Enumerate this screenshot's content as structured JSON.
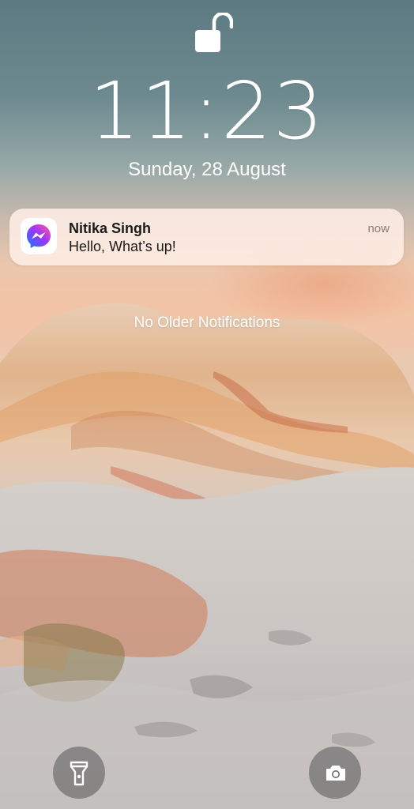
{
  "lockscreen": {
    "time": "11:23",
    "date": "Sunday, 28 August",
    "no_older_text": "No Older Notifications"
  },
  "notification": {
    "app_icon": "messenger-icon",
    "sender": "Nitika Singh",
    "message": "Hello, What’s up!",
    "time": "now"
  },
  "controls": {
    "left_icon": "flashlight-icon",
    "right_icon": "camera-icon"
  },
  "colors": {
    "messenger_gradient_start": "#0a7cff",
    "messenger_gradient_mid": "#a033ff",
    "messenger_gradient_end": "#ff5c87"
  }
}
